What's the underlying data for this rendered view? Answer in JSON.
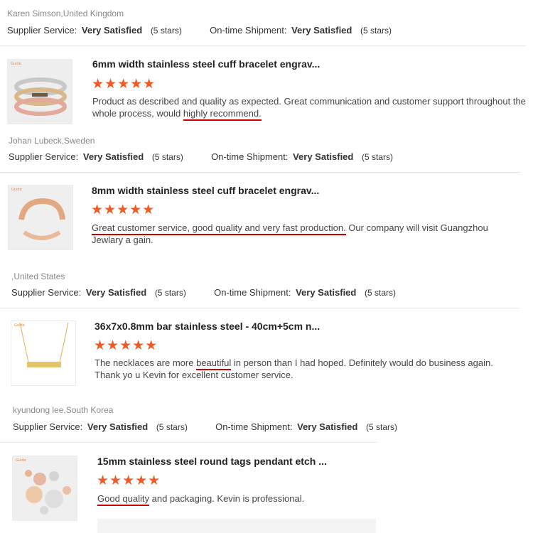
{
  "labels": {
    "supplier_service": "Supplier Service:",
    "ontime_shipment": "On-time Shipment:",
    "very_satisfied": "Very Satisfied",
    "five_stars": "(5 stars)",
    "stars_glyph": "★★★★★",
    "thumb_tag": "Guide"
  },
  "reviews": [
    {
      "reviewer": "Karen Simson,United Kingdom",
      "rating_supplier": "Very Satisfied",
      "rating_shipment": "Very Satisfied"
    },
    {
      "product_title": "6mm width stainless steel cuff bracelet engrav...",
      "comment_underlined": "highly recommend.",
      "comment_before": "Product as described and quality as expected. Great communication and customer support throughout the whole process, would ",
      "comment_after": "",
      "reviewer": "Johan Lubeck,Sweden",
      "rating_supplier": "Very Satisfied",
      "rating_shipment": "Very Satisfied"
    },
    {
      "product_title": "8mm width stainless steel cuff bracelet engrav...",
      "comment_before": "",
      "comment_underlined": "Great customer service, good quality and very fast production.",
      "comment_after": " Our company will visit Guangzhou Jewlary a gain.",
      "reviewer": ",United States",
      "rating_supplier": "Very Satisfied",
      "rating_shipment": "Very Satisfied"
    },
    {
      "product_title": "36x7x0.8mm bar stainless steel - 40cm+5cm n...",
      "comment_before": "The necklaces are more ",
      "comment_underlined": "beautiful",
      "comment_after": " in person than I had hoped. Definitely would do business again. Thank yo u Kevin for excellent customer service.",
      "reviewer": "kyundong lee,South Korea",
      "rating_supplier": "Very Satisfied",
      "rating_shipment": "Very Satisfied"
    },
    {
      "product_title": "15mm stainless steel round tags pendant etch ...",
      "comment_before": "",
      "comment_underlined": "Good quality",
      "comment_after": " and packaging. Kevin is professional."
    }
  ]
}
